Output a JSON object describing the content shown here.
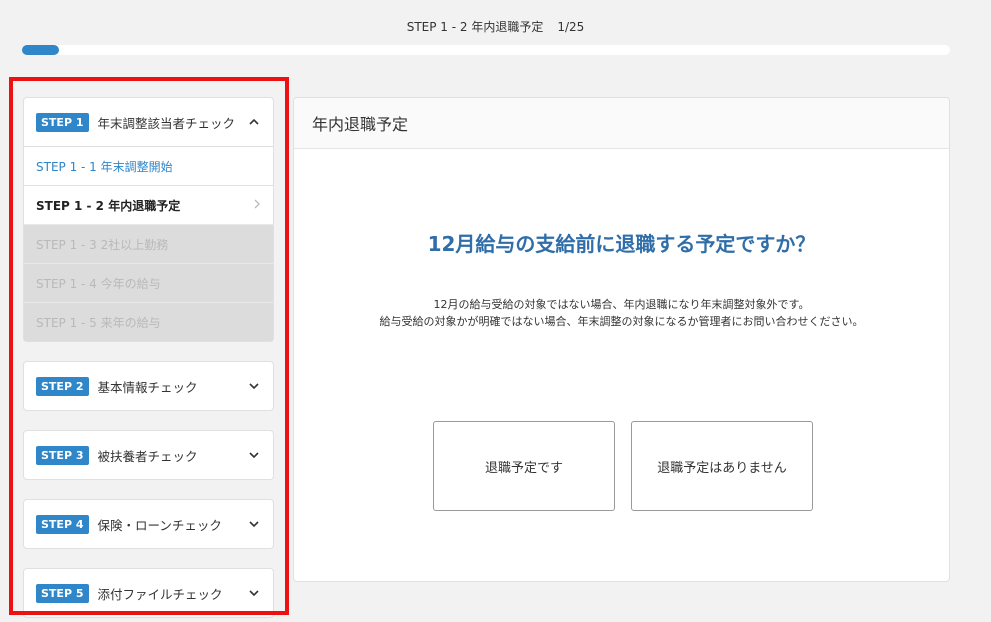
{
  "header": {
    "step_title": "STEP 1 - 2 年内退職予定",
    "page_count": "1/25",
    "progress_fraction": 0.04
  },
  "sidebar": {
    "expanded_step": {
      "badge": "STEP 1",
      "label": "年末調整該当者チェック",
      "substeps": [
        {
          "label": "STEP 1 - 1  年末調整開始",
          "state": "link"
        },
        {
          "label": "STEP 1 - 2  年内退職予定",
          "state": "current"
        },
        {
          "label": "STEP 1 - 3  2社以上勤務",
          "state": "disabled"
        },
        {
          "label": "STEP 1 - 4  今年の給与",
          "state": "disabled"
        },
        {
          "label": "STEP 1 - 5  来年の給与",
          "state": "disabled"
        }
      ]
    },
    "collapsed_steps": [
      {
        "badge": "STEP 2",
        "label": "基本情報チェック"
      },
      {
        "badge": "STEP 3",
        "label": "被扶養者チェック"
      },
      {
        "badge": "STEP 4",
        "label": "保険・ローンチェック"
      },
      {
        "badge": "STEP 5",
        "label": "添付ファイルチェック"
      }
    ]
  },
  "main": {
    "card_title": "年内退職予定",
    "question": "12月給与の支給前に退職する予定ですか？",
    "desc_line1": "12月の給与受給の対象ではない場合、年内退職になり年末調整対象外です。",
    "desc_line2": "給与受給の対象かが明確ではない場合、年末調整の対象になるか管理者にお問い合わせください。",
    "button_yes": "退職予定です",
    "button_no": "退職予定はありません"
  },
  "colors": {
    "accent": "#2f86c9",
    "highlight_border": "#ee1111"
  }
}
